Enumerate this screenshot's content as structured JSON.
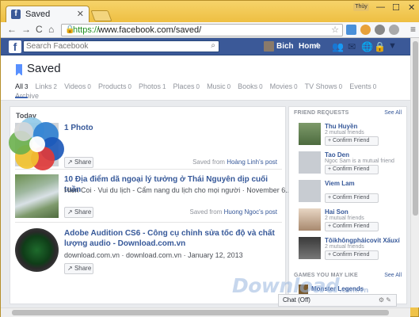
{
  "browser": {
    "tab_title": "Saved",
    "tab_close": "✕",
    "user_badge": "Thùy",
    "minimize": "—",
    "maximize": "☐",
    "close": "✕",
    "url_scheme": "https://",
    "url_rest": "www.facebook.com/saved/",
    "back": "←",
    "forward": "→",
    "reload": "C",
    "home": "⌂",
    "star": "☆",
    "menu": "≡"
  },
  "fbbar": {
    "logo": "f",
    "search_placeholder": "Search Facebook",
    "search_icon": "🔍",
    "profile_name": "Bich",
    "home_label": "Home",
    "home_count": "4",
    "icons": [
      "friends-icon",
      "messages-icon",
      "notifications-icon",
      "privacy-icon"
    ],
    "dropdown": "▼"
  },
  "saved": {
    "title": "Saved",
    "filters": [
      {
        "label": "All",
        "count": "3"
      },
      {
        "label": "Links",
        "count": "2"
      },
      {
        "label": "Videos",
        "count": "0"
      },
      {
        "label": "Products",
        "count": "0"
      },
      {
        "label": "Photos",
        "count": "1"
      },
      {
        "label": "Places",
        "count": "0"
      },
      {
        "label": "Music",
        "count": "0"
      },
      {
        "label": "Books",
        "count": "0"
      },
      {
        "label": "Movies",
        "count": "0"
      },
      {
        "label": "TV Shows",
        "count": "0"
      },
      {
        "label": "Events",
        "count": "0"
      },
      {
        "label": "Archive",
        "count": ""
      }
    ]
  },
  "main": {
    "section_label": "Today",
    "items": [
      {
        "title": "1 Photo",
        "sub": "",
        "share_label": "Share",
        "saved_from_prefix": "Saved from ",
        "saved_from_link": "Hoàng Linh's post"
      },
      {
        "title": "10 Địa điểm dã ngoại lý tưởng ở Thái Nguyên dịp cuối tuần",
        "sub": "Hien Coi · Vui du lịch - Cẩm nang du lịch cho mọi người · November 6...",
        "share_label": "Share",
        "saved_from_prefix": "Saved from ",
        "saved_from_link": "Huong Ngoc's post"
      },
      {
        "title": "Adobe Audition CS6 - Công cụ chỉnh sửa tốc độ và chất lượng audio - Download.com.vn",
        "sub": "download.com.vn · download.com.vn · January 12, 2013",
        "share_label": "Share",
        "saved_from_prefix": "",
        "saved_from_link": ""
      }
    ]
  },
  "side": {
    "friend_requests_label": "FRIEND REQUESTS",
    "see_all": "See All",
    "confirm_label": "Confirm Friend",
    "friends": [
      {
        "name": "Thu Huyền",
        "mutual": "2 mutual friends"
      },
      {
        "name": "Tao Den",
        "mutual": "Ngoc Sam is a mutual friend"
      },
      {
        "name": "Viem Lam",
        "mutual": ""
      },
      {
        "name": "Hai Son",
        "mutual": "2 mutual friends"
      },
      {
        "name": "Tôikhôngphảicovit Xấuxí",
        "mutual": "2 mutual friends"
      }
    ],
    "games_label": "GAMES YOU MAY LIKE",
    "games_see_all": "See All",
    "game_name": "Monster Legends"
  },
  "chat": {
    "label": "Chat (Off)"
  },
  "watermark": {
    "text": "Download",
    "suffix": ".com.vn"
  }
}
